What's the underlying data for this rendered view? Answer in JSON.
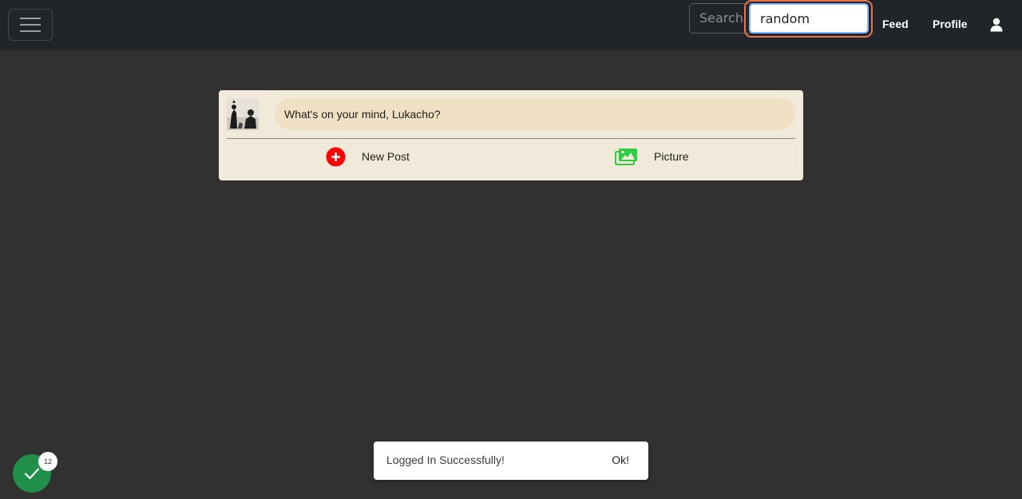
{
  "navbar": {
    "menu_icon": "hamburger-icon",
    "search": {
      "button_label": "Search",
      "value": "random"
    },
    "links": {
      "feed": "Feed",
      "profile": "Profile"
    },
    "user_icon": "user-icon"
  },
  "composer": {
    "prompt": "What's on your mind, Lukacho?",
    "actions": {
      "new_post": "New Post",
      "picture": "Picture"
    },
    "colors": {
      "new_post_icon": "#ff0000",
      "picture_icon": "#2ecc40"
    }
  },
  "toast": {
    "message": "Logged In Successfully!",
    "ok_label": "Ok!"
  },
  "status": {
    "icon": "check-icon",
    "count": "12",
    "color": "#1f8f4a"
  }
}
